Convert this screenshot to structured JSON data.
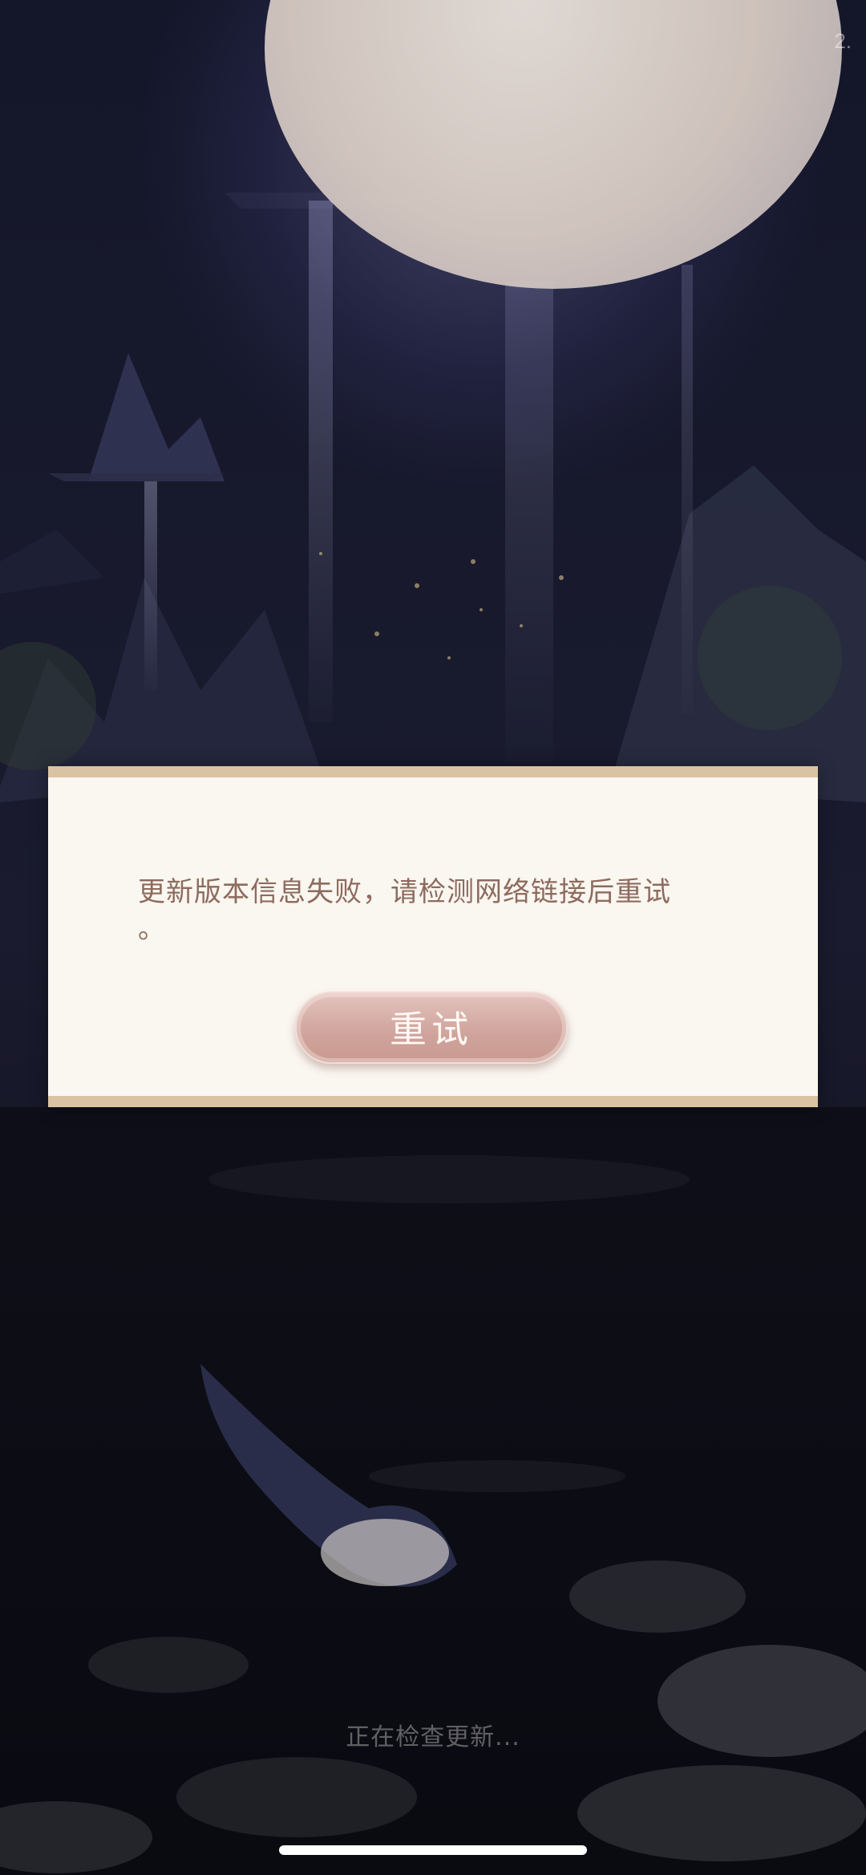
{
  "version_text": "2.",
  "dialog": {
    "message_line1": "更新版本信息失败，请检测网络链接后重试",
    "message_line2": "。",
    "retry_label": "重试"
  },
  "status_text": "正在检查更新...",
  "colors": {
    "dialog_bg": "#faf6f0",
    "dialog_border": "#d9c3a2",
    "message_text": "#8d6b5e",
    "button": "#cfa39b",
    "background": "#0a0b14"
  }
}
